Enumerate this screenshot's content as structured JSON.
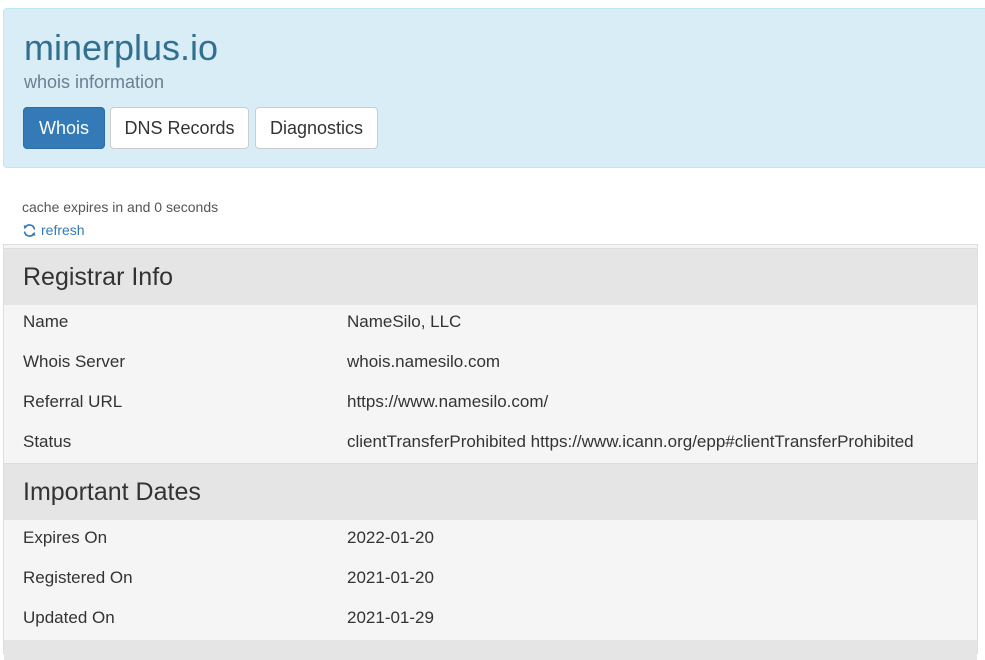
{
  "header": {
    "domain": "minerplus.io",
    "subtitle": "whois information",
    "tabs": [
      {
        "label": "Whois",
        "active": true
      },
      {
        "label": "DNS Records",
        "active": false
      },
      {
        "label": "Diagnostics",
        "active": false
      }
    ]
  },
  "cache": {
    "note": "cache expires in and 0 seconds",
    "refresh_label": "refresh",
    "refresh_icon": "refresh-icon"
  },
  "sections": [
    {
      "title": "Registrar Info",
      "rows": [
        {
          "key": "Name",
          "value": "NameSilo, LLC"
        },
        {
          "key": "Whois Server",
          "value": "whois.namesilo.com"
        },
        {
          "key": "Referral URL",
          "value": "https://www.namesilo.com/"
        },
        {
          "key": "Status",
          "value": "clientTransferProhibited https://www.icann.org/epp#clientTransferProhibited"
        }
      ]
    },
    {
      "title": "Important Dates",
      "rows": [
        {
          "key": "Expires On",
          "value": "2022-01-20"
        },
        {
          "key": "Registered On",
          "value": "2021-01-20"
        },
        {
          "key": "Updated On",
          "value": "2021-01-29"
        }
      ]
    }
  ],
  "colors": {
    "header_bg": "#d9edf7",
    "title": "#31708f",
    "active_tab": "#337ab7",
    "link": "#337ab7",
    "section_bg": "#e5e5e5",
    "row_bg": "#f5f5f5"
  }
}
